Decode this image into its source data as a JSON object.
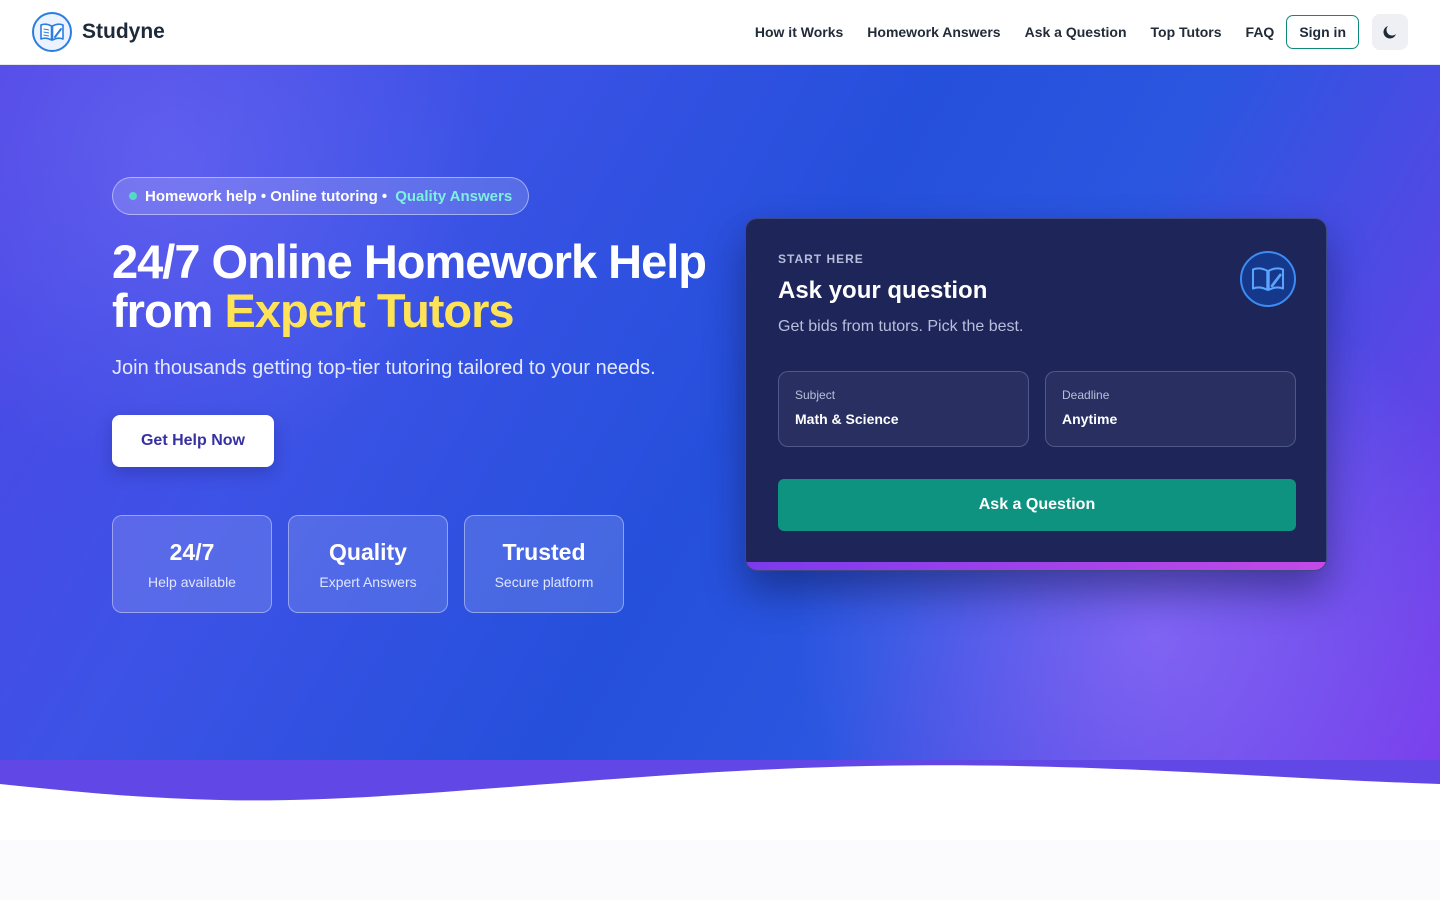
{
  "brand": {
    "name": "Studyne",
    "logo_icon": "book-pen-icon"
  },
  "nav": {
    "links": [
      "How it Works",
      "Homework Answers",
      "Ask a Question",
      "Top Tutors",
      "FAQ"
    ],
    "signin": "Sign in",
    "theme_icon": "moon-icon"
  },
  "hero": {
    "pill": {
      "part1": "Homework help • Online tutoring •",
      "highlight": "Quality Answers"
    },
    "headline": {
      "line1": "24/7 Online Homework Help",
      "line2_prefix": "from",
      "line2_accent": "Expert Tutors"
    },
    "subtitle": "Join thousands getting top-tier tutoring tailored to your needs.",
    "cta": "Get Help Now",
    "stats": [
      {
        "value": "24/7",
        "label": "Help available"
      },
      {
        "value": "Quality",
        "label": "Expert Answers"
      },
      {
        "value": "Trusted",
        "label": "Secure platform"
      }
    ]
  },
  "card": {
    "eyebrow": "START HERE",
    "title": "Ask your question",
    "subtitle": "Get bids from tutors. Pick the best.",
    "fields": [
      {
        "label": "Subject",
        "value": "Math & Science"
      },
      {
        "label": "Deadline",
        "value": "Anytime"
      }
    ],
    "button": "Ask a Question"
  },
  "colors": {
    "accent_yellow": "#ffe357",
    "teal": "#0e9381",
    "indigo": "#4f46e5",
    "card_bg": "#1e2559"
  }
}
